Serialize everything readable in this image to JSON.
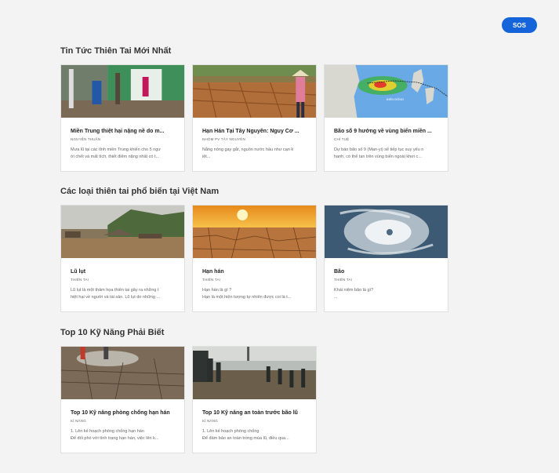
{
  "sos_label": "SOS",
  "sections": [
    {
      "title": "Tin Tức Thiên Tai Mới Nhất",
      "cards": [
        {
          "title": "Miền Trung thiệt hại nặng nề do m...",
          "author": "NGUYỄN THUẬN",
          "desc1": "Mưa lũ tại các tỉnh miền Trung khiến cho 5 ngư",
          "desc2": "ời chết và mất tích, thiết điểm nặng nhất có t..."
        },
        {
          "title": "Hạn Hán Tại Tây Nguyên: Nguy Cơ ...",
          "author": "NHÓM PV TÂY NGUYÊN",
          "desc1": "Nắng nóng gay gắt, nguồn nước hầu như cạn k",
          "desc2": "iệt..."
        },
        {
          "title": "Bão số 9 hướng về vùng biển miền ...",
          "author": "CHÍ TUỆ",
          "desc1": "Dự báo bão số 9 (Man-yi) sẽ tiếp tục suy yếu n",
          "desc2": "hanh, có thể tan trên vùng biển ngoài khơi c..."
        }
      ]
    },
    {
      "title": "Các loại thiên tai phổ biến tại Việt Nam",
      "cards": [
        {
          "title": "Lũ lụt",
          "author": "THIÊN TAI",
          "desc1": "Lũ lụt là một thảm họa thiên tai gây ra những t",
          "desc2": "hiệt hại về người và tài sản. Lũ lụt do những ..."
        },
        {
          "title": "Hạn hán",
          "author": "THIÊN TAI",
          "desc1": "Hạn hán là gì ?",
          "desc2": "Hạn là một hiện tượng tự nhiên được coi là t..."
        },
        {
          "title": "Bão",
          "author": "THIÊN TAI",
          "desc1": "Khái niệm bão là gì?",
          "desc2": "..."
        }
      ]
    },
    {
      "title": "Top 10 Kỹ Năng Phải Biết",
      "cards": [
        {
          "title": "Top 10 Kỹ năng phòng chống hạn hán",
          "author": "KĨ NĂNG",
          "desc1": "1. Lên kế hoạch phòng chống hạn hán",
          "desc2": "Để đối phó với tình trạng hạn hán, việc lên k..."
        },
        {
          "title": "Top 10 Kỹ năng an toàn trước bão lũ",
          "author": "KĨ NĂNG",
          "desc1": "1. Lên kế hoạch phòng chống",
          "desc2": "Để đảm bảo an toàn trong mùa lũ, điều qua..."
        }
      ]
    }
  ]
}
